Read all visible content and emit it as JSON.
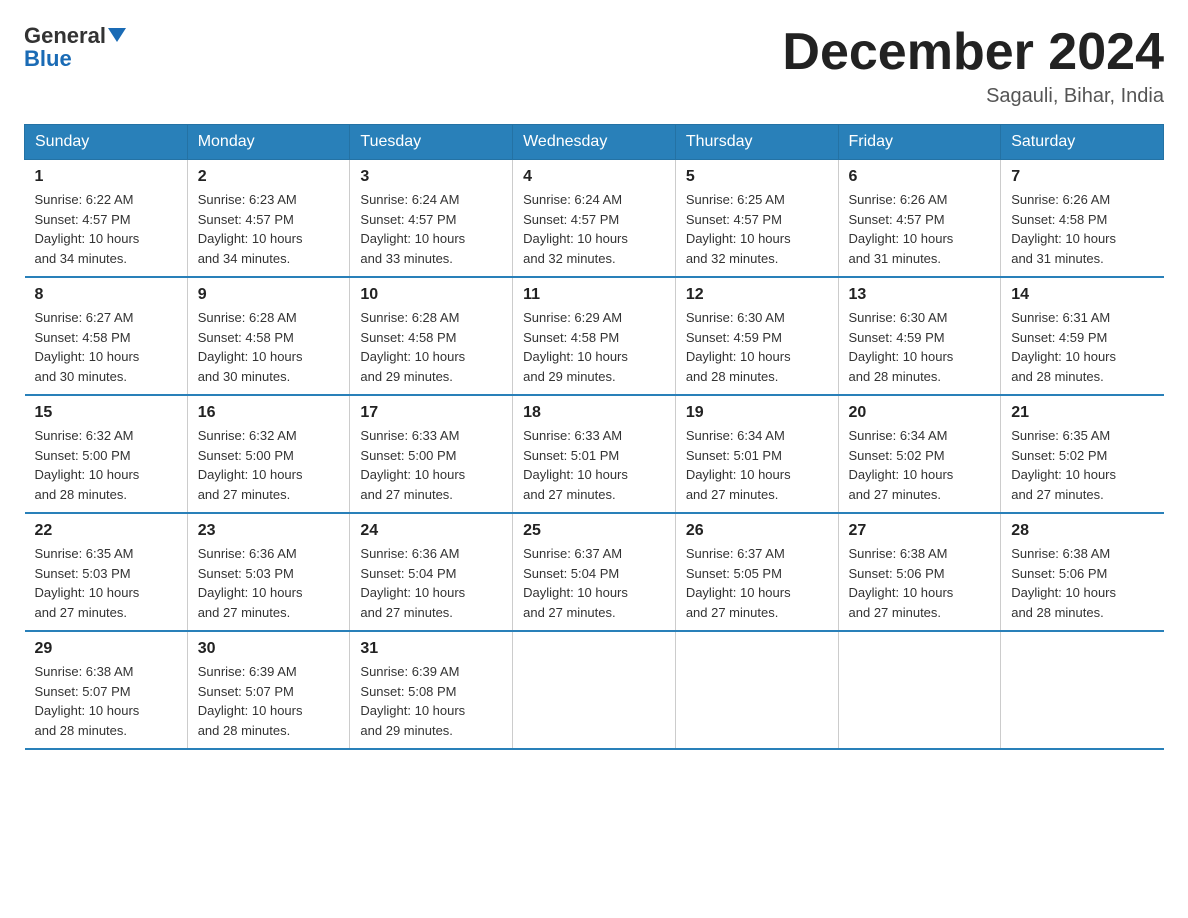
{
  "header": {
    "logo_line1": "General",
    "logo_line2": "Blue",
    "month_title": "December 2024",
    "location": "Sagauli, Bihar, India"
  },
  "days_of_week": [
    "Sunday",
    "Monday",
    "Tuesday",
    "Wednesday",
    "Thursday",
    "Friday",
    "Saturday"
  ],
  "weeks": [
    [
      {
        "day": "1",
        "sunrise": "6:22 AM",
        "sunset": "4:57 PM",
        "daylight": "10 hours and 34 minutes."
      },
      {
        "day": "2",
        "sunrise": "6:23 AM",
        "sunset": "4:57 PM",
        "daylight": "10 hours and 34 minutes."
      },
      {
        "day": "3",
        "sunrise": "6:24 AM",
        "sunset": "4:57 PM",
        "daylight": "10 hours and 33 minutes."
      },
      {
        "day": "4",
        "sunrise": "6:24 AM",
        "sunset": "4:57 PM",
        "daylight": "10 hours and 32 minutes."
      },
      {
        "day": "5",
        "sunrise": "6:25 AM",
        "sunset": "4:57 PM",
        "daylight": "10 hours and 32 minutes."
      },
      {
        "day": "6",
        "sunrise": "6:26 AM",
        "sunset": "4:57 PM",
        "daylight": "10 hours and 31 minutes."
      },
      {
        "day": "7",
        "sunrise": "6:26 AM",
        "sunset": "4:58 PM",
        "daylight": "10 hours and 31 minutes."
      }
    ],
    [
      {
        "day": "8",
        "sunrise": "6:27 AM",
        "sunset": "4:58 PM",
        "daylight": "10 hours and 30 minutes."
      },
      {
        "day": "9",
        "sunrise": "6:28 AM",
        "sunset": "4:58 PM",
        "daylight": "10 hours and 30 minutes."
      },
      {
        "day": "10",
        "sunrise": "6:28 AM",
        "sunset": "4:58 PM",
        "daylight": "10 hours and 29 minutes."
      },
      {
        "day": "11",
        "sunrise": "6:29 AM",
        "sunset": "4:58 PM",
        "daylight": "10 hours and 29 minutes."
      },
      {
        "day": "12",
        "sunrise": "6:30 AM",
        "sunset": "4:59 PM",
        "daylight": "10 hours and 28 minutes."
      },
      {
        "day": "13",
        "sunrise": "6:30 AM",
        "sunset": "4:59 PM",
        "daylight": "10 hours and 28 minutes."
      },
      {
        "day": "14",
        "sunrise": "6:31 AM",
        "sunset": "4:59 PM",
        "daylight": "10 hours and 28 minutes."
      }
    ],
    [
      {
        "day": "15",
        "sunrise": "6:32 AM",
        "sunset": "5:00 PM",
        "daylight": "10 hours and 28 minutes."
      },
      {
        "day": "16",
        "sunrise": "6:32 AM",
        "sunset": "5:00 PM",
        "daylight": "10 hours and 27 minutes."
      },
      {
        "day": "17",
        "sunrise": "6:33 AM",
        "sunset": "5:00 PM",
        "daylight": "10 hours and 27 minutes."
      },
      {
        "day": "18",
        "sunrise": "6:33 AM",
        "sunset": "5:01 PM",
        "daylight": "10 hours and 27 minutes."
      },
      {
        "day": "19",
        "sunrise": "6:34 AM",
        "sunset": "5:01 PM",
        "daylight": "10 hours and 27 minutes."
      },
      {
        "day": "20",
        "sunrise": "6:34 AM",
        "sunset": "5:02 PM",
        "daylight": "10 hours and 27 minutes."
      },
      {
        "day": "21",
        "sunrise": "6:35 AM",
        "sunset": "5:02 PM",
        "daylight": "10 hours and 27 minutes."
      }
    ],
    [
      {
        "day": "22",
        "sunrise": "6:35 AM",
        "sunset": "5:03 PM",
        "daylight": "10 hours and 27 minutes."
      },
      {
        "day": "23",
        "sunrise": "6:36 AM",
        "sunset": "5:03 PM",
        "daylight": "10 hours and 27 minutes."
      },
      {
        "day": "24",
        "sunrise": "6:36 AM",
        "sunset": "5:04 PM",
        "daylight": "10 hours and 27 minutes."
      },
      {
        "day": "25",
        "sunrise": "6:37 AM",
        "sunset": "5:04 PM",
        "daylight": "10 hours and 27 minutes."
      },
      {
        "day": "26",
        "sunrise": "6:37 AM",
        "sunset": "5:05 PM",
        "daylight": "10 hours and 27 minutes."
      },
      {
        "day": "27",
        "sunrise": "6:38 AM",
        "sunset": "5:06 PM",
        "daylight": "10 hours and 27 minutes."
      },
      {
        "day": "28",
        "sunrise": "6:38 AM",
        "sunset": "5:06 PM",
        "daylight": "10 hours and 28 minutes."
      }
    ],
    [
      {
        "day": "29",
        "sunrise": "6:38 AM",
        "sunset": "5:07 PM",
        "daylight": "10 hours and 28 minutes."
      },
      {
        "day": "30",
        "sunrise": "6:39 AM",
        "sunset": "5:07 PM",
        "daylight": "10 hours and 28 minutes."
      },
      {
        "day": "31",
        "sunrise": "6:39 AM",
        "sunset": "5:08 PM",
        "daylight": "10 hours and 29 minutes."
      },
      null,
      null,
      null,
      null
    ]
  ],
  "labels": {
    "sunrise": "Sunrise:",
    "sunset": "Sunset:",
    "daylight": "Daylight:"
  }
}
